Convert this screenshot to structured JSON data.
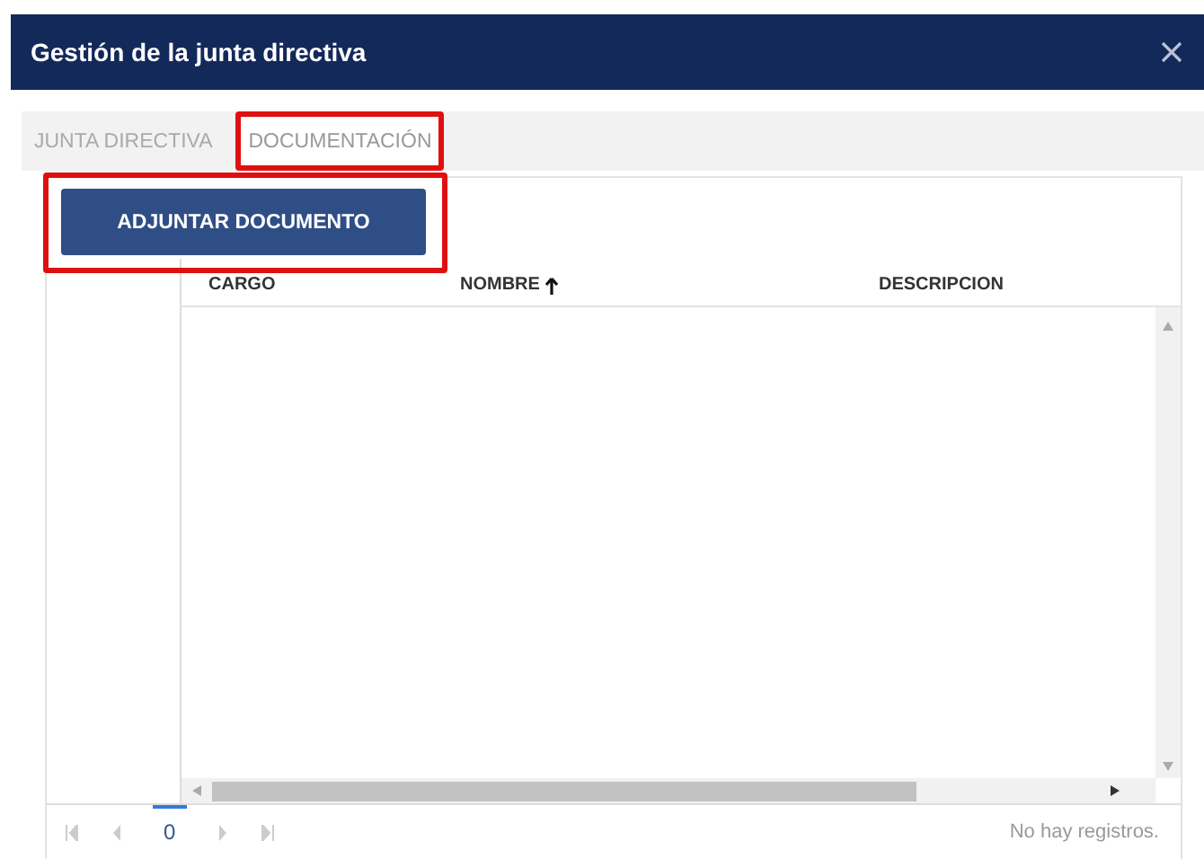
{
  "window": {
    "title": "Gestión de la junta directiva"
  },
  "tabs": [
    {
      "label": "JUNTA DIRECTIVA",
      "selected": false,
      "highlighted": false
    },
    {
      "label": "DOCUMENTACIÓN",
      "selected": true,
      "highlighted": true
    }
  ],
  "attach_button": {
    "label": "ADJUNTAR DOCUMENTO",
    "highlighted": true
  },
  "table": {
    "columns": [
      {
        "label": "CARGO",
        "sorted_ascending": false
      },
      {
        "label": "NOMBRE",
        "sorted_ascending": true
      },
      {
        "label": "DESCRIPCION",
        "sorted_ascending": false
      }
    ]
  },
  "pager": {
    "page": "0",
    "status": "No hay registros."
  }
}
